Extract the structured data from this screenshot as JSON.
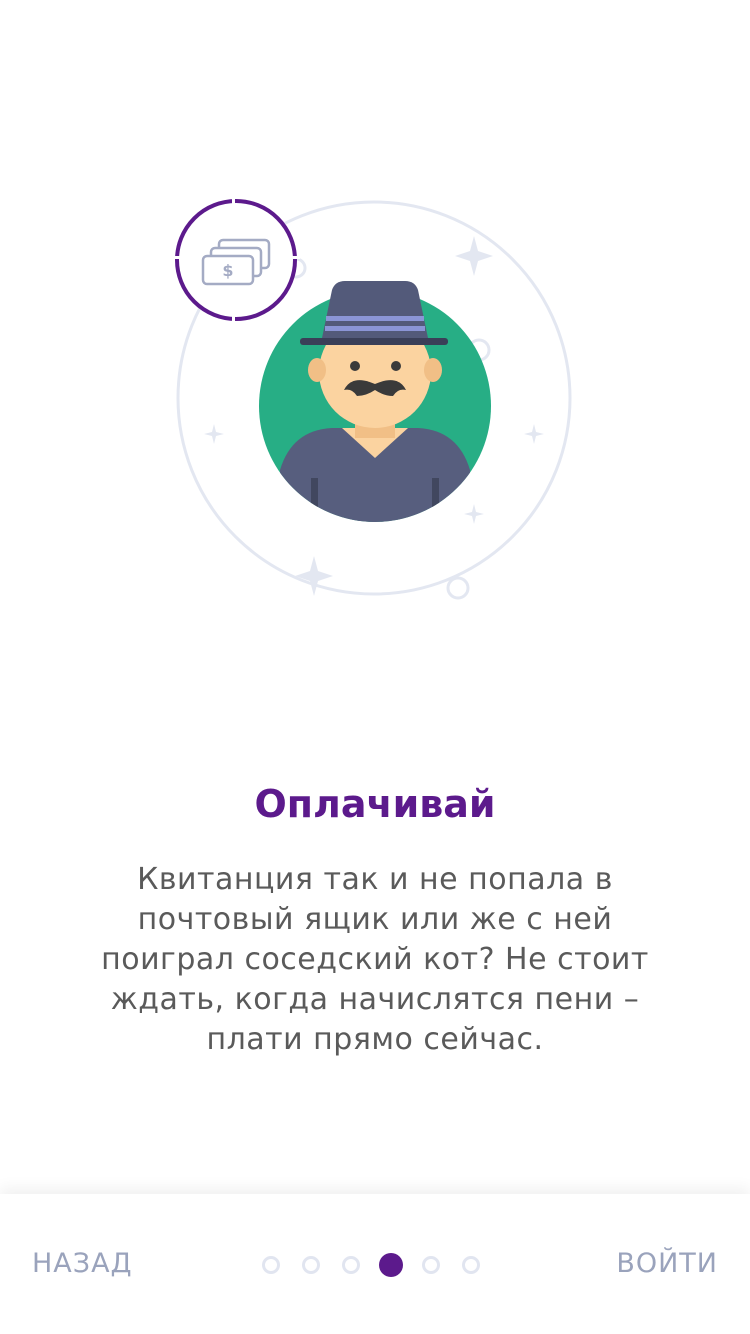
{
  "onboarding": {
    "title": "Оплачивай",
    "description": "Квитанция так и не попала в почтовый ящик или же с ней поиграл соседский кот? Не стоит ждать, когда начислятся пени – плати прямо сейчас."
  },
  "navigation": {
    "back_label": "НАЗАД",
    "login_label": "ВОЙТИ",
    "pages_total": 6,
    "current_page": 4
  },
  "colors": {
    "accent": "#5c1a8c",
    "green_circle": "#27ae85",
    "hat": "#535a7a",
    "hat_band": "#8b95d6",
    "skin": "#fbd3a0",
    "shirt": "#575e7e",
    "orbit": "#e1e5f0",
    "inactive_dot": "#e1e5f0",
    "nav_text": "#9aa3bc"
  },
  "icons": {
    "badge": "money-bills-icon"
  }
}
